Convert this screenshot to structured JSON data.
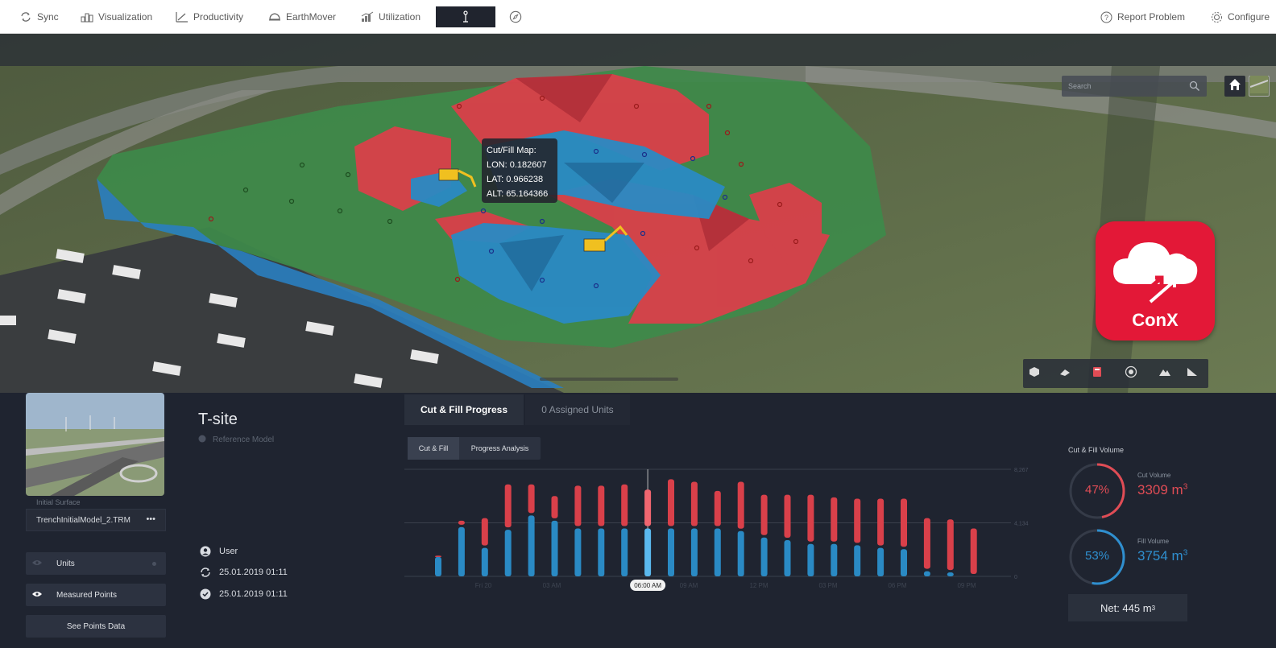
{
  "nav": {
    "items": [
      {
        "label": "Sync",
        "icon": "sync-icon"
      },
      {
        "label": "Visualization",
        "icon": "visualization-icon"
      },
      {
        "label": "Productivity",
        "icon": "productivity-icon"
      },
      {
        "label": "EarthMover",
        "icon": "earthmover-icon"
      },
      {
        "label": "Utilization",
        "icon": "utilization-icon"
      }
    ],
    "active_icon": "survey-pole-icon",
    "compass_icon": "compass-icon",
    "report_label": "Report Problem",
    "configure_label": "Configure"
  },
  "map": {
    "search_placeholder": "Search",
    "tooltip": {
      "title": "Cut/Fill Map:",
      "lon": "LON: 0.182607",
      "lat": "LAT: 0.966238",
      "alt": "ALT: 65.164366"
    },
    "logo_text": "ConX",
    "colors": {
      "cut": "#d9404a",
      "fill": "#2a8ac4",
      "ground": "#3e8a4a"
    }
  },
  "panel": {
    "initial_surface_label": "Initial Surface",
    "initial_surface_value": "TrenchInitialModel_2.TRM",
    "more_label": "•••",
    "units_label": "Units",
    "measured_points_label": "Measured Points",
    "see_points_label": "See Points Data",
    "site_title": "T-site",
    "reference_model": "Reference Model",
    "user_label": "User",
    "synced_date": "25.01.2019 01:11",
    "completed_date": "25.01.2019 01:11",
    "tabs": [
      "Cut & Fill Progress",
      "0 Assigned Units"
    ],
    "subtabs": [
      "Cut & Fill",
      "Progress Analysis"
    ],
    "volume": {
      "title": "Cut & Fill Volume",
      "cut_label": "Cut Volume",
      "cut_value": "3309 m",
      "cut_pct": "47%",
      "cut_fraction": 0.47,
      "fill_label": "Fill Volume",
      "fill_value": "3754 m",
      "fill_pct": "53%",
      "fill_fraction": 0.53,
      "net_label": "Net: 445 m",
      "unit_sup": "3",
      "cut_color": "#e04c55",
      "fill_color": "#2f8fcf"
    }
  },
  "chart_data": {
    "type": "bar",
    "x_ticks": [
      "Fri 20",
      "03 AM",
      "06:00 AM",
      "09 AM",
      "12 PM",
      "03 PM",
      "06 PM",
      "09 PM"
    ],
    "highlight_label": "06:00 AM",
    "y_ticks": [
      "0",
      "4,134",
      "8,267"
    ],
    "ylim": [
      0,
      8267
    ],
    "series": [
      {
        "values": [
          1600,
          4300,
          4500,
          7100,
          7100,
          6200,
          7000,
          7000,
          7100,
          6700,
          7500,
          7300,
          6600,
          7300,
          6300,
          6300,
          6300,
          6100,
          6000,
          6000,
          6000,
          4500,
          4400,
          3700
        ]
      },
      {
        "values": [
          1500,
          3800,
          2200,
          3600,
          4700,
          4300,
          3700,
          3700,
          3700,
          3700,
          3700,
          3700,
          3700,
          3500,
          3000,
          2800,
          2500,
          2500,
          2400,
          2200,
          2100,
          400,
          300,
          0
        ]
      }
    ]
  }
}
